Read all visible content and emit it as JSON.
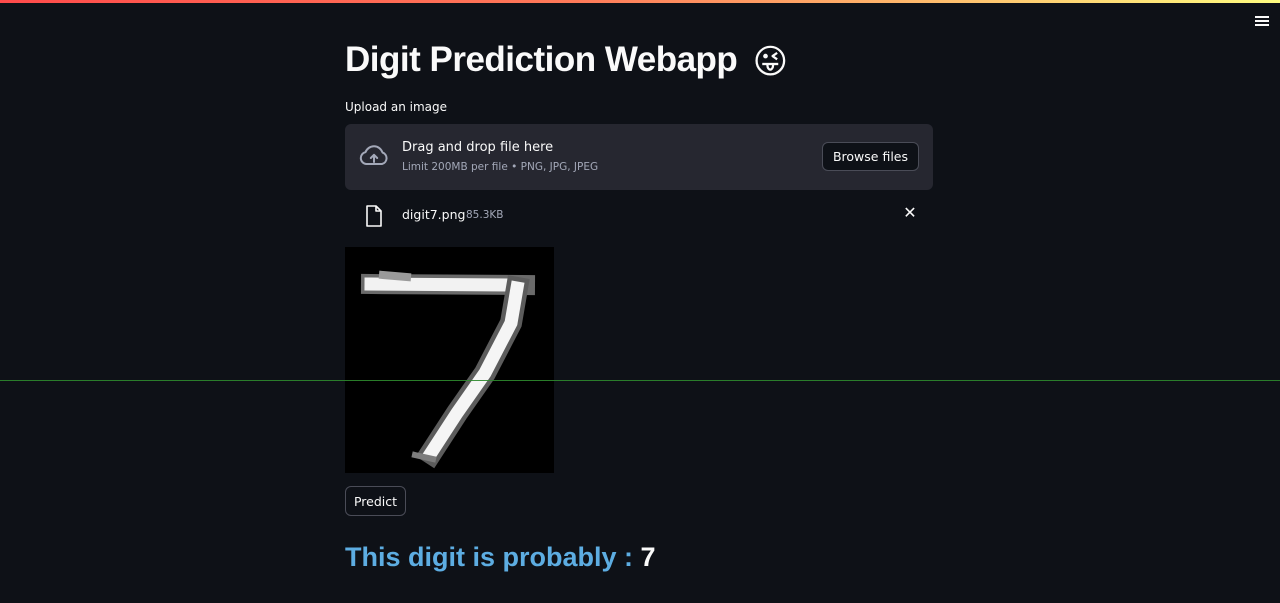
{
  "app": {
    "title": "Digit Prediction Webapp",
    "title_emoji": "😜"
  },
  "uploader": {
    "label": "Upload an image",
    "drop_title": "Drag and drop file here",
    "drop_limit": "Limit 200MB per file • PNG, JPG, JPEG",
    "browse_label": "Browse files"
  },
  "uploaded_file": {
    "name": "digit7.png",
    "size": "85.3KB"
  },
  "actions": {
    "predict_label": "Predict"
  },
  "result": {
    "label": "This digit is probably :",
    "value": "7"
  },
  "colors": {
    "background": "#0e1117",
    "dropzone": "#262730",
    "result_label": "#5dade2",
    "text": "#fafafa",
    "muted_text": "#a3a8b8"
  },
  "icons": {
    "menu": "hamburger-icon",
    "upload": "cloud-upload-icon",
    "file": "file-icon",
    "remove": "close-icon"
  }
}
